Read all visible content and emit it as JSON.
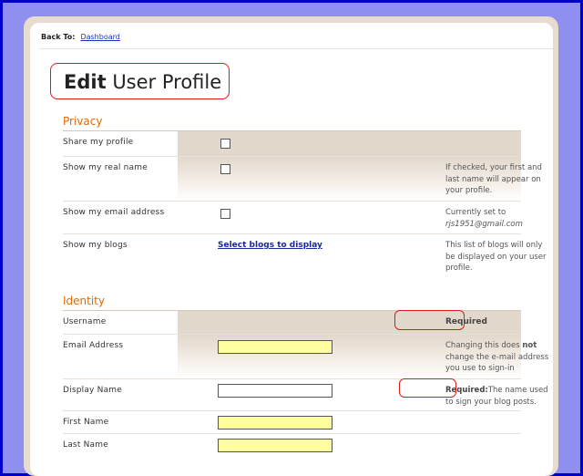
{
  "nav": {
    "back_to": "Back To:",
    "dashboard": "Dashboard"
  },
  "title": {
    "bold": "Edit",
    "rest": "User Profile"
  },
  "privacy": {
    "heading": "Privacy",
    "share_profile": "Share my profile",
    "show_real_name": "Show my real name",
    "show_real_name_help_1": "If checked, your first and",
    "show_real_name_help_2": "last name will appear on",
    "show_real_name_help_3": "your profile.",
    "show_email": "Show my email address",
    "email_help_1": "Currently set to",
    "email_help_2": "rjs1951@gmail.com",
    "show_blogs": "Show my blogs",
    "select_blogs": "Select blogs to display",
    "blogs_help_1": "This list of blogs will only",
    "blogs_help_2": "be displayed on your user",
    "blogs_help_3": "profile."
  },
  "identity": {
    "heading": "Identity",
    "username": "Username",
    "username_req": "Required",
    "email": "Email Address",
    "email_help_1": "Changing this does",
    "email_help_not": "not",
    "email_help_2": "change the e-mail address",
    "email_help_3": "you use to sign-in",
    "display_name": "Display Name",
    "display_req": "Required:",
    "display_help_1": "The name used",
    "display_help_2": "to sign your blog posts.",
    "first_name": "First Name",
    "last_name": "Last Name"
  },
  "colors": {
    "accent": "#e06a00",
    "required_circle": "#e01818",
    "input_fill": "#ffffa0",
    "outer_border": "#0000c8"
  }
}
